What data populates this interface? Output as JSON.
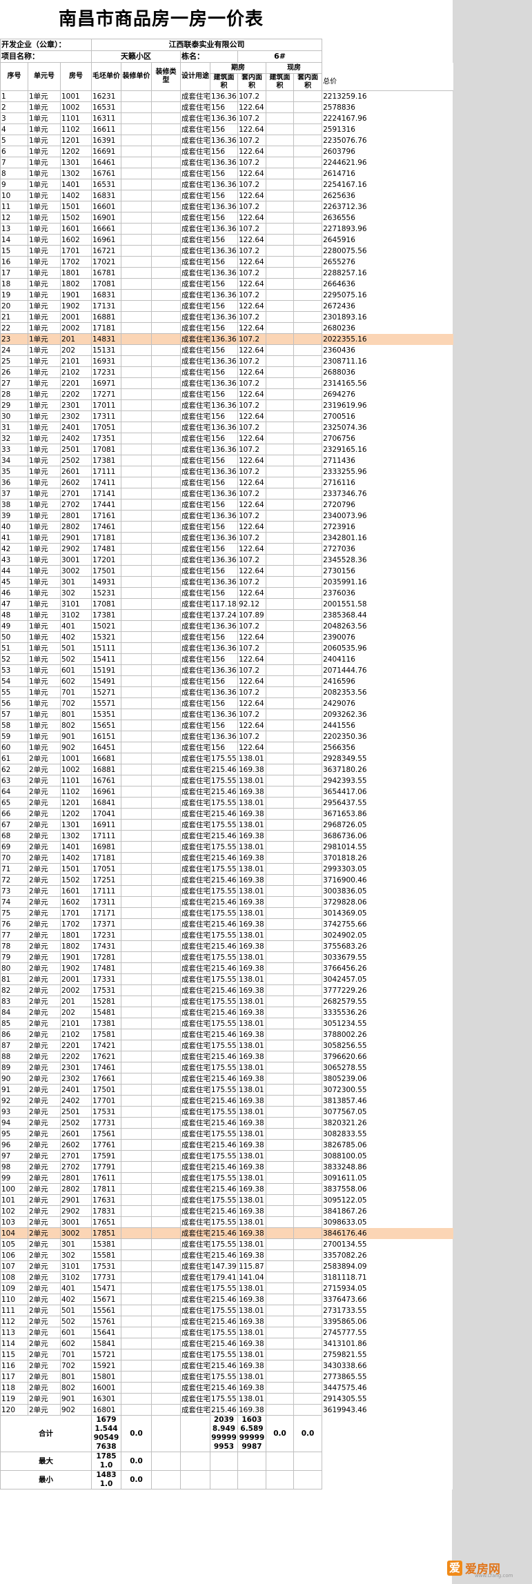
{
  "title": "南昌市商品房一房一价表",
  "meta": {
    "developer_label": "开发企业（公章）：",
    "developer_value": "江西联泰实业有限公司",
    "project_label": "项目名称：",
    "project_value": "天籁小区",
    "building_label": "栋名：",
    "building_value": "6#"
  },
  "headers": {
    "seq": "序号",
    "unit": "单元号",
    "room": "房号",
    "rough_price": "毛坯单价",
    "deco_price": "装修单价",
    "deco_type": "装修类型",
    "usage": "设计用途",
    "presale": "期房",
    "existing": "现房",
    "built_area": "建筑面积",
    "inner_area": "套内面积",
    "total": "总价"
  },
  "rows": [
    [
      "1",
      "1单元",
      "1001",
      "16231",
      "成套住宅",
      "136.36",
      "107.2",
      "2213259.16"
    ],
    [
      "2",
      "1单元",
      "1002",
      "16531",
      "成套住宅",
      "156",
      "122.64",
      "2578836"
    ],
    [
      "3",
      "1单元",
      "1101",
      "16311",
      "成套住宅",
      "136.36",
      "107.2",
      "2224167.96"
    ],
    [
      "4",
      "1单元",
      "1102",
      "16611",
      "成套住宅",
      "156",
      "122.64",
      "2591316"
    ],
    [
      "5",
      "1单元",
      "1201",
      "16391",
      "成套住宅",
      "136.36",
      "107.2",
      "2235076.76"
    ],
    [
      "6",
      "1单元",
      "1202",
      "16691",
      "成套住宅",
      "156",
      "122.64",
      "2603796"
    ],
    [
      "7",
      "1单元",
      "1301",
      "16461",
      "成套住宅",
      "136.36",
      "107.2",
      "2244621.96"
    ],
    [
      "8",
      "1单元",
      "1302",
      "16761",
      "成套住宅",
      "156",
      "122.64",
      "2614716"
    ],
    [
      "9",
      "1单元",
      "1401",
      "16531",
      "成套住宅",
      "136.36",
      "107.2",
      "2254167.16"
    ],
    [
      "10",
      "1单元",
      "1402",
      "16831",
      "成套住宅",
      "156",
      "122.64",
      "2625636"
    ],
    [
      "11",
      "1单元",
      "1501",
      "16601",
      "成套住宅",
      "136.36",
      "107.2",
      "2263712.36"
    ],
    [
      "12",
      "1单元",
      "1502",
      "16901",
      "成套住宅",
      "156",
      "122.64",
      "2636556"
    ],
    [
      "13",
      "1单元",
      "1601",
      "16661",
      "成套住宅",
      "136.36",
      "107.2",
      "2271893.96"
    ],
    [
      "14",
      "1单元",
      "1602",
      "16961",
      "成套住宅",
      "156",
      "122.64",
      "2645916"
    ],
    [
      "15",
      "1单元",
      "1701",
      "16721",
      "成套住宅",
      "136.36",
      "107.2",
      "2280075.56"
    ],
    [
      "16",
      "1单元",
      "1702",
      "17021",
      "成套住宅",
      "156",
      "122.64",
      "2655276"
    ],
    [
      "17",
      "1单元",
      "1801",
      "16781",
      "成套住宅",
      "136.36",
      "107.2",
      "2288257.16"
    ],
    [
      "18",
      "1单元",
      "1802",
      "17081",
      "成套住宅",
      "156",
      "122.64",
      "2664636"
    ],
    [
      "19",
      "1单元",
      "1901",
      "16831",
      "成套住宅",
      "136.36",
      "107.2",
      "2295075.16"
    ],
    [
      "20",
      "1单元",
      "1902",
      "17131",
      "成套住宅",
      "156",
      "122.64",
      "2672436"
    ],
    [
      "21",
      "1单元",
      "2001",
      "16881",
      "成套住宅",
      "136.36",
      "107.2",
      "2301893.16"
    ],
    [
      "22",
      "1单元",
      "2002",
      "17181",
      "成套住宅",
      "156",
      "122.64",
      "2680236"
    ],
    [
      "23",
      "1单元",
      "201",
      "14831",
      "成套住宅",
      "136.36",
      "107.2",
      "2022355.16"
    ],
    [
      "24",
      "1单元",
      "202",
      "15131",
      "成套住宅",
      "156",
      "122.64",
      "2360436"
    ],
    [
      "25",
      "1单元",
      "2101",
      "16931",
      "成套住宅",
      "136.36",
      "107.2",
      "2308711.16"
    ],
    [
      "26",
      "1单元",
      "2102",
      "17231",
      "成套住宅",
      "156",
      "122.64",
      "2688036"
    ],
    [
      "27",
      "1单元",
      "2201",
      "16971",
      "成套住宅",
      "136.36",
      "107.2",
      "2314165.56"
    ],
    [
      "28",
      "1单元",
      "2202",
      "17271",
      "成套住宅",
      "156",
      "122.64",
      "2694276"
    ],
    [
      "29",
      "1单元",
      "2301",
      "17011",
      "成套住宅",
      "136.36",
      "107.2",
      "2319619.96"
    ],
    [
      "30",
      "1单元",
      "2302",
      "17311",
      "成套住宅",
      "156",
      "122.64",
      "2700516"
    ],
    [
      "31",
      "1单元",
      "2401",
      "17051",
      "成套住宅",
      "136.36",
      "107.2",
      "2325074.36"
    ],
    [
      "32",
      "1单元",
      "2402",
      "17351",
      "成套住宅",
      "156",
      "122.64",
      "2706756"
    ],
    [
      "33",
      "1单元",
      "2501",
      "17081",
      "成套住宅",
      "136.36",
      "107.2",
      "2329165.16"
    ],
    [
      "34",
      "1单元",
      "2502",
      "17381",
      "成套住宅",
      "156",
      "122.64",
      "2711436"
    ],
    [
      "35",
      "1单元",
      "2601",
      "17111",
      "成套住宅",
      "136.36",
      "107.2",
      "2333255.96"
    ],
    [
      "36",
      "1单元",
      "2602",
      "17411",
      "成套住宅",
      "156",
      "122.64",
      "2716116"
    ],
    [
      "37",
      "1单元",
      "2701",
      "17141",
      "成套住宅",
      "136.36",
      "107.2",
      "2337346.76"
    ],
    [
      "38",
      "1单元",
      "2702",
      "17441",
      "成套住宅",
      "156",
      "122.64",
      "2720796"
    ],
    [
      "39",
      "1单元",
      "2801",
      "17161",
      "成套住宅",
      "136.36",
      "107.2",
      "2340073.96"
    ],
    [
      "40",
      "1单元",
      "2802",
      "17461",
      "成套住宅",
      "156",
      "122.64",
      "2723916"
    ],
    [
      "41",
      "1单元",
      "2901",
      "17181",
      "成套住宅",
      "136.36",
      "107.2",
      "2342801.16"
    ],
    [
      "42",
      "1单元",
      "2902",
      "17481",
      "成套住宅",
      "156",
      "122.64",
      "2727036"
    ],
    [
      "43",
      "1单元",
      "3001",
      "17201",
      "成套住宅",
      "136.36",
      "107.2",
      "2345528.36"
    ],
    [
      "44",
      "1单元",
      "3002",
      "17501",
      "成套住宅",
      "156",
      "122.64",
      "2730156"
    ],
    [
      "45",
      "1单元",
      "301",
      "14931",
      "成套住宅",
      "136.36",
      "107.2",
      "2035991.16"
    ],
    [
      "46",
      "1单元",
      "302",
      "15231",
      "成套住宅",
      "156",
      "122.64",
      "2376036"
    ],
    [
      "47",
      "1单元",
      "3101",
      "17081",
      "成套住宅",
      "117.18",
      "92.12",
      "2001551.58"
    ],
    [
      "48",
      "1单元",
      "3102",
      "17381",
      "成套住宅",
      "137.24",
      "107.89",
      "2385368.44"
    ],
    [
      "49",
      "1单元",
      "401",
      "15021",
      "成套住宅",
      "136.36",
      "107.2",
      "2048263.56"
    ],
    [
      "50",
      "1单元",
      "402",
      "15321",
      "成套住宅",
      "156",
      "122.64",
      "2390076"
    ],
    [
      "51",
      "1单元",
      "501",
      "15111",
      "成套住宅",
      "136.36",
      "107.2",
      "2060535.96"
    ],
    [
      "52",
      "1单元",
      "502",
      "15411",
      "成套住宅",
      "156",
      "122.64",
      "2404116"
    ],
    [
      "53",
      "1单元",
      "601",
      "15191",
      "成套住宅",
      "136.36",
      "107.2",
      "2071444.76"
    ],
    [
      "54",
      "1单元",
      "602",
      "15491",
      "成套住宅",
      "156",
      "122.64",
      "2416596"
    ],
    [
      "55",
      "1单元",
      "701",
      "15271",
      "成套住宅",
      "136.36",
      "107.2",
      "2082353.56"
    ],
    [
      "56",
      "1单元",
      "702",
      "15571",
      "成套住宅",
      "156",
      "122.64",
      "2429076"
    ],
    [
      "57",
      "1单元",
      "801",
      "15351",
      "成套住宅",
      "136.36",
      "107.2",
      "2093262.36"
    ],
    [
      "58",
      "1单元",
      "802",
      "15651",
      "成套住宅",
      "156",
      "122.64",
      "2441556"
    ],
    [
      "59",
      "1单元",
      "901",
      "16151",
      "成套住宅",
      "136.36",
      "107.2",
      "2202350.36"
    ],
    [
      "60",
      "1单元",
      "902",
      "16451",
      "成套住宅",
      "156",
      "122.64",
      "2566356"
    ],
    [
      "61",
      "2单元",
      "1001",
      "16681",
      "成套住宅",
      "175.55",
      "138.01",
      "2928349.55"
    ],
    [
      "62",
      "2单元",
      "1002",
      "16881",
      "成套住宅",
      "215.46",
      "169.38",
      "3637180.26"
    ],
    [
      "63",
      "2单元",
      "1101",
      "16761",
      "成套住宅",
      "175.55",
      "138.01",
      "2942393.55"
    ],
    [
      "64",
      "2单元",
      "1102",
      "16961",
      "成套住宅",
      "215.46",
      "169.38",
      "3654417.06"
    ],
    [
      "65",
      "2单元",
      "1201",
      "16841",
      "成套住宅",
      "175.55",
      "138.01",
      "2956437.55"
    ],
    [
      "66",
      "2单元",
      "1202",
      "17041",
      "成套住宅",
      "215.46",
      "169.38",
      "3671653.86"
    ],
    [
      "67",
      "2单元",
      "1301",
      "16911",
      "成套住宅",
      "175.55",
      "138.01",
      "2968726.05"
    ],
    [
      "68",
      "2单元",
      "1302",
      "17111",
      "成套住宅",
      "215.46",
      "169.38",
      "3686736.06"
    ],
    [
      "69",
      "2单元",
      "1401",
      "16981",
      "成套住宅",
      "175.55",
      "138.01",
      "2981014.55"
    ],
    [
      "70",
      "2单元",
      "1402",
      "17181",
      "成套住宅",
      "215.46",
      "169.38",
      "3701818.26"
    ],
    [
      "71",
      "2单元",
      "1501",
      "17051",
      "成套住宅",
      "175.55",
      "138.01",
      "2993303.05"
    ],
    [
      "72",
      "2单元",
      "1502",
      "17251",
      "成套住宅",
      "215.46",
      "169.38",
      "3716900.46"
    ],
    [
      "73",
      "2单元",
      "1601",
      "17111",
      "成套住宅",
      "175.55",
      "138.01",
      "3003836.05"
    ],
    [
      "74",
      "2单元",
      "1602",
      "17311",
      "成套住宅",
      "215.46",
      "169.38",
      "3729828.06"
    ],
    [
      "75",
      "2单元",
      "1701",
      "17171",
      "成套住宅",
      "175.55",
      "138.01",
      "3014369.05"
    ],
    [
      "76",
      "2单元",
      "1702",
      "17371",
      "成套住宅",
      "215.46",
      "169.38",
      "3742755.66"
    ],
    [
      "77",
      "2单元",
      "1801",
      "17231",
      "成套住宅",
      "175.55",
      "138.01",
      "3024902.05"
    ],
    [
      "78",
      "2单元",
      "1802",
      "17431",
      "成套住宅",
      "215.46",
      "169.38",
      "3755683.26"
    ],
    [
      "79",
      "2单元",
      "1901",
      "17281",
      "成套住宅",
      "175.55",
      "138.01",
      "3033679.55"
    ],
    [
      "80",
      "2单元",
      "1902",
      "17481",
      "成套住宅",
      "215.46",
      "169.38",
      "3766456.26"
    ],
    [
      "81",
      "2单元",
      "2001",
      "17331",
      "成套住宅",
      "175.55",
      "138.01",
      "3042457.05"
    ],
    [
      "82",
      "2单元",
      "2002",
      "17531",
      "成套住宅",
      "215.46",
      "169.38",
      "3777229.26"
    ],
    [
      "83",
      "2单元",
      "201",
      "15281",
      "成套住宅",
      "175.55",
      "138.01",
      "2682579.55"
    ],
    [
      "84",
      "2单元",
      "202",
      "15481",
      "成套住宅",
      "215.46",
      "169.38",
      "3335536.26"
    ],
    [
      "85",
      "2单元",
      "2101",
      "17381",
      "成套住宅",
      "175.55",
      "138.01",
      "3051234.55"
    ],
    [
      "86",
      "2单元",
      "2102",
      "17581",
      "成套住宅",
      "215.46",
      "169.38",
      "3788002.26"
    ],
    [
      "87",
      "2单元",
      "2201",
      "17421",
      "成套住宅",
      "175.55",
      "138.01",
      "3058256.55"
    ],
    [
      "88",
      "2单元",
      "2202",
      "17621",
      "成套住宅",
      "215.46",
      "169.38",
      "3796620.66"
    ],
    [
      "89",
      "2单元",
      "2301",
      "17461",
      "成套住宅",
      "175.55",
      "138.01",
      "3065278.55"
    ],
    [
      "90",
      "2单元",
      "2302",
      "17661",
      "成套住宅",
      "215.46",
      "169.38",
      "3805239.06"
    ],
    [
      "91",
      "2单元",
      "2401",
      "17501",
      "成套住宅",
      "175.55",
      "138.01",
      "3072300.55"
    ],
    [
      "92",
      "2单元",
      "2402",
      "17701",
      "成套住宅",
      "215.46",
      "169.38",
      "3813857.46"
    ],
    [
      "93",
      "2单元",
      "2501",
      "17531",
      "成套住宅",
      "175.55",
      "138.01",
      "3077567.05"
    ],
    [
      "94",
      "2单元",
      "2502",
      "17731",
      "成套住宅",
      "215.46",
      "169.38",
      "3820321.26"
    ],
    [
      "95",
      "2单元",
      "2601",
      "17561",
      "成套住宅",
      "175.55",
      "138.01",
      "3082833.55"
    ],
    [
      "96",
      "2单元",
      "2602",
      "17761",
      "成套住宅",
      "215.46",
      "169.38",
      "3826785.06"
    ],
    [
      "97",
      "2单元",
      "2701",
      "17591",
      "成套住宅",
      "175.55",
      "138.01",
      "3088100.05"
    ],
    [
      "98",
      "2单元",
      "2702",
      "17791",
      "成套住宅",
      "215.46",
      "169.38",
      "3833248.86"
    ],
    [
      "99",
      "2单元",
      "2801",
      "17611",
      "成套住宅",
      "175.55",
      "138.01",
      "3091611.05"
    ],
    [
      "100",
      "2单元",
      "2802",
      "17811",
      "成套住宅",
      "215.46",
      "169.38",
      "3837558.06"
    ],
    [
      "101",
      "2单元",
      "2901",
      "17631",
      "成套住宅",
      "175.55",
      "138.01",
      "3095122.05"
    ],
    [
      "102",
      "2单元",
      "2902",
      "17831",
      "成套住宅",
      "215.46",
      "169.38",
      "3841867.26"
    ],
    [
      "103",
      "2单元",
      "3001",
      "17651",
      "成套住宅",
      "175.55",
      "138.01",
      "3098633.05"
    ],
    [
      "104",
      "2单元",
      "3002",
      "17851",
      "成套住宅",
      "215.46",
      "169.38",
      "3846176.46"
    ],
    [
      "105",
      "2单元",
      "301",
      "15381",
      "成套住宅",
      "175.55",
      "138.01",
      "2700134.55"
    ],
    [
      "106",
      "2单元",
      "302",
      "15581",
      "成套住宅",
      "215.46",
      "169.38",
      "3357082.26"
    ],
    [
      "107",
      "2单元",
      "3101",
      "17531",
      "成套住宅",
      "147.39",
      "115.87",
      "2583894.09"
    ],
    [
      "108",
      "2单元",
      "3102",
      "17731",
      "成套住宅",
      "179.41",
      "141.04",
      "3181118.71"
    ],
    [
      "109",
      "2单元",
      "401",
      "15471",
      "成套住宅",
      "175.55",
      "138.01",
      "2715934.05"
    ],
    [
      "110",
      "2单元",
      "402",
      "15671",
      "成套住宅",
      "215.46",
      "169.38",
      "3376473.66"
    ],
    [
      "111",
      "2单元",
      "501",
      "15561",
      "成套住宅",
      "175.55",
      "138.01",
      "2731733.55"
    ],
    [
      "112",
      "2单元",
      "502",
      "15761",
      "成套住宅",
      "215.46",
      "169.38",
      "3395865.06"
    ],
    [
      "113",
      "2单元",
      "601",
      "15641",
      "成套住宅",
      "175.55",
      "138.01",
      "2745777.55"
    ],
    [
      "114",
      "2单元",
      "602",
      "15841",
      "成套住宅",
      "215.46",
      "169.38",
      "3413101.86"
    ],
    [
      "115",
      "2单元",
      "701",
      "15721",
      "成套住宅",
      "175.55",
      "138.01",
      "2759821.55"
    ],
    [
      "116",
      "2单元",
      "702",
      "15921",
      "成套住宅",
      "215.46",
      "169.38",
      "3430338.66"
    ],
    [
      "117",
      "2单元",
      "801",
      "15801",
      "成套住宅",
      "175.55",
      "138.01",
      "2773865.55"
    ],
    [
      "118",
      "2单元",
      "802",
      "16001",
      "成套住宅",
      "215.46",
      "169.38",
      "3447575.46"
    ],
    [
      "119",
      "2单元",
      "901",
      "16301",
      "成套住宅",
      "175.55",
      "138.01",
      "2914305.55"
    ],
    [
      "120",
      "2单元",
      "902",
      "16801",
      "成套住宅",
      "215.46",
      "169.38",
      "3619943.46"
    ]
  ],
  "highlight_rows": [
    23,
    104
  ],
  "summary": {
    "total_label": "合计",
    "total_rough_price": "16791.544905497638",
    "total_deco_price": "0.0",
    "total_built_area": "20398.949999999953",
    "total_inner_area": "16036.589999999987",
    "total_existing_built": "0.0",
    "total_existing_inner": "0.0",
    "max_label": "最大",
    "max_rough_price": "17851.0",
    "max_deco_price": "0.0",
    "min_label": "最小",
    "min_rough_price": "14831.0",
    "min_deco_price": "0.0"
  },
  "watermark": {
    "logo_char": "爱",
    "site_name": "爱房网",
    "site_url": "www.Lfang.com"
  },
  "colors": {
    "highlight": "#fbd5b5",
    "sidebar_gray": "#d9d9d9",
    "logo_orange": "#f08a19"
  }
}
